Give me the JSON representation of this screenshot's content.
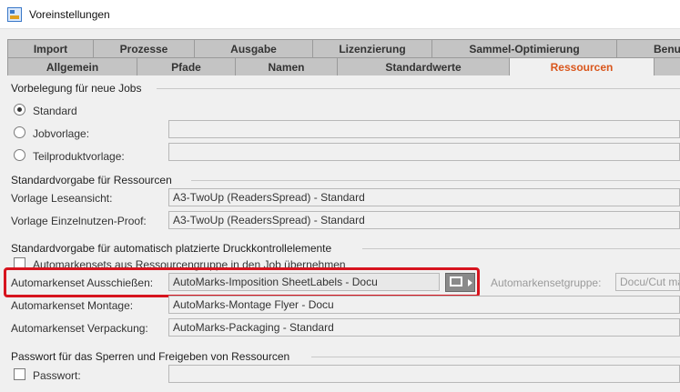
{
  "window": {
    "title": "Voreinstellungen"
  },
  "tabs_row1": [
    "Import",
    "Prozesse",
    "Ausgabe",
    "Lizenzierung",
    "Sammel-Optimierung",
    "Benutz"
  ],
  "tabs_row2": [
    "Allgemein",
    "Pfade",
    "Namen",
    "Standardwerte",
    "Ressourcen"
  ],
  "active_tab": "Ressourcen",
  "jobs": {
    "title": "Vorbelegung für neue Jobs",
    "standard_label": "Standard",
    "jobvorlage_label": "Jobvorlage:",
    "teilprodukt_label": "Teilproduktvorlage:",
    "selected": "Standard"
  },
  "ressourcen": {
    "title": "Standardvorgabe für Ressourcen",
    "lese_label": "Vorlage Leseansicht:",
    "lese_value": "A3-TwoUp (ReadersSpread) - Standard",
    "einzel_label": "Vorlage Einzelnutzen-Proof:",
    "einzel_value": "A3-TwoUp (ReadersSpread) - Standard"
  },
  "druck": {
    "title": "Standardvorgabe für automatisch platzierte Druckkontrollelemente",
    "checkbox_label": "Automarkensets aus Ressourcengruppe in den Job übernehmen",
    "ausschiessen_label": "Automarkenset Ausschießen:",
    "ausschiessen_value": "AutoMarks-Imposition SheetLabels - Docu",
    "gruppe_label": "Automarkensetgruppe:",
    "gruppe_value": "Docu/Cut ma",
    "montage_label": "Automarkenset Montage:",
    "montage_value": "AutoMarks-Montage Flyer - Docu",
    "verpackung_label": "Automarkenset Verpackung:",
    "verpackung_value": "AutoMarks-Packaging - Standard"
  },
  "passwort": {
    "title": "Passwort für das Sperren und Freigeben von Ressourcen",
    "label": "Passwort:"
  },
  "icons": {
    "app": "app-icon",
    "picker": "monitor-picker-icon"
  },
  "colors": {
    "active_tab": "#d9561c",
    "highlight": "#d7141e"
  }
}
